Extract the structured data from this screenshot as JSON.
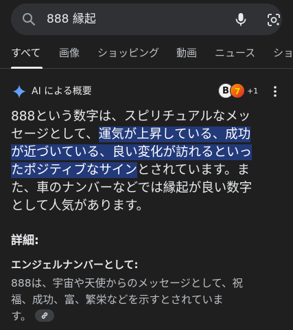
{
  "search": {
    "query": "888 縁起"
  },
  "tabs": [
    {
      "label": "すべて",
      "active": true
    },
    {
      "label": "画像"
    },
    {
      "label": "ショッピング"
    },
    {
      "label": "動画"
    },
    {
      "label": "ニュース"
    },
    {
      "label": "ショ"
    }
  ],
  "ai_overview": {
    "title": "AI による概要",
    "sources_extra": "+1",
    "answer_lines": [
      {
        "plain": "888という数字は、スピリチュアルなメッ"
      },
      {
        "plain": "セージとして、",
        "highlight": "運気が上昇している、成功"
      },
      {
        "highlight": "が近づいている、良い変化が訪れるといっ"
      },
      {
        "highlight": "たポジティブなサイン",
        "plain_after": "とされています。ま"
      },
      {
        "plain": "た、車のナンバーなどでは縁起が良い数字"
      },
      {
        "plain": "として人気があります。"
      }
    ],
    "details_heading": "詳細:",
    "angel_heading": "エンジェルナンバーとして:",
    "angel_text_lines": [
      "888は、宇宙や天使からのメッセージとして、祝",
      "福、成功、富、繁栄などを示すとされていま",
      "す。"
    ]
  },
  "colors": {
    "background": "#1f1f1f",
    "search_bar": "#303134",
    "highlight": "#233a7a",
    "ai_spark": "#4c8df6"
  }
}
